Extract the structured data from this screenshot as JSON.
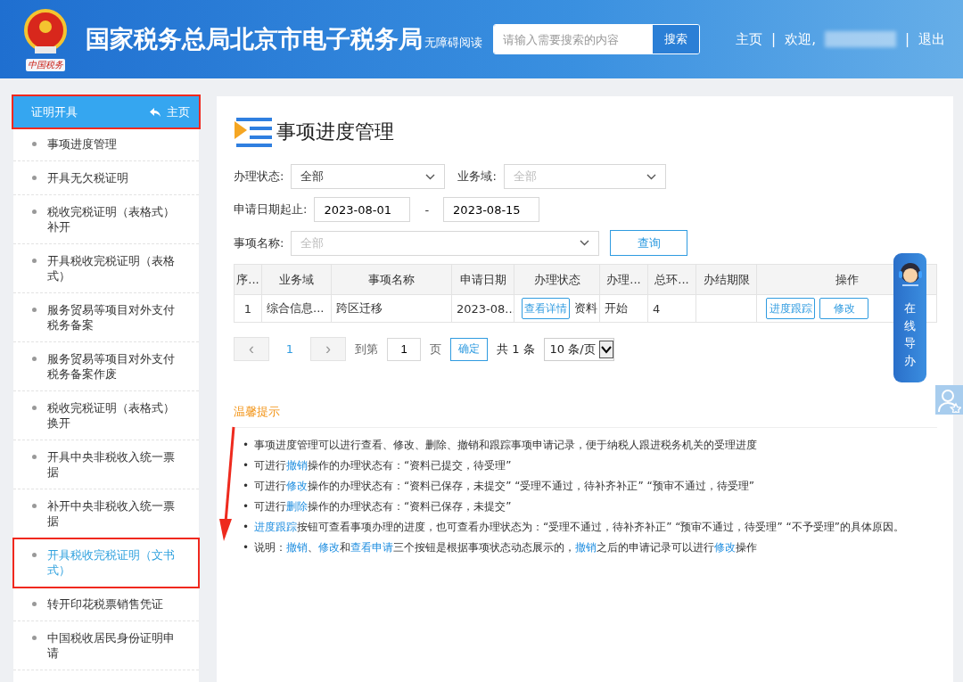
{
  "header": {
    "seal_text": "中国税务",
    "title": "国家税务总局北京市电子税务局",
    "accessibility": "无障碍阅读",
    "search": {
      "placeholder": "请输入需要搜索的内容",
      "button": "搜索"
    },
    "nav": [
      {
        "kind": "link",
        "text": "主页"
      },
      {
        "kind": "sep",
        "text": "|"
      },
      {
        "kind": "text",
        "text": "欢迎,"
      },
      {
        "kind": "sep",
        "text": "|"
      },
      {
        "kind": "link",
        "text": "退出"
      }
    ]
  },
  "sidebar": {
    "title": "证明开具",
    "home": "主页",
    "highlighted": true,
    "items": [
      {
        "label": "事项进度管理",
        "selected": false,
        "highlighted": false
      },
      {
        "label": "开具无欠税证明",
        "selected": false,
        "highlighted": false
      },
      {
        "label": "税收完税证明（表格式）补开",
        "selected": false,
        "highlighted": false
      },
      {
        "label": "开具税收完税证明（表格式）",
        "selected": false,
        "highlighted": false
      },
      {
        "label": "服务贸易等项目对外支付税务备案",
        "selected": false,
        "highlighted": false
      },
      {
        "label": "服务贸易等项目对外支付税务备案作废",
        "selected": false,
        "highlighted": false
      },
      {
        "label": "税收完税证明（表格式）换开",
        "selected": false,
        "highlighted": false
      },
      {
        "label": "开具中央非税收入统一票据",
        "selected": false,
        "highlighted": false
      },
      {
        "label": "补开中央非税收入统一票据",
        "selected": false,
        "highlighted": false
      },
      {
        "label": "开具税收完税证明（文书式）",
        "selected": true,
        "highlighted": true
      },
      {
        "label": "转开印花税票销售凭证",
        "selected": false,
        "highlighted": false
      },
      {
        "label": "中国税收居民身份证明申请",
        "selected": false,
        "highlighted": false
      }
    ]
  },
  "page_title": "事项进度管理",
  "filters": {
    "status": {
      "label": "办理状态:",
      "value": "全部"
    },
    "domain": {
      "label": "业务域:",
      "placeholder": "全部"
    },
    "date": {
      "label": "申请日期起止:",
      "from": "2023-08-01",
      "dash": "-",
      "to": "2023-08-15"
    },
    "name": {
      "label": "事项名称:",
      "placeholder": "全部"
    },
    "query_button": "查询"
  },
  "table": {
    "columns": [
      "序...",
      "业务域",
      "事项名称",
      "申请日期",
      "办理状态",
      "办理...",
      "总环...",
      "办结期限",
      "操作"
    ],
    "rows": [
      {
        "cells": [
          "1",
          "综合信息...",
          "跨区迁移",
          "2023-08...",
          "资料",
          "开始",
          "4",
          ""
        ],
        "detail_button": "查看详情",
        "actions": [
          "进度跟踪",
          "修改"
        ]
      }
    ]
  },
  "pagination": {
    "prev": "‹",
    "pages": [
      {
        "label": "1",
        "selected": true
      }
    ],
    "next": "›",
    "goto": "到第",
    "page_value": "1",
    "page_unit": "页",
    "confirm": "确定",
    "total": "共 1 条",
    "page_size": "10 条/页"
  },
  "tips": {
    "title": "温馨提示",
    "items": [
      {
        "marker": "•",
        "parts": [
          {
            "text": "事项进度管理可以进行查看、修改、删除、撤销和跟踪事项申请记录，便于纳税人跟进税务机关的受理进度",
            "link": false
          }
        ]
      },
      {
        "marker": "•",
        "parts": [
          {
            "text": "可进行",
            "link": false
          },
          {
            "text": "撤销",
            "link": true
          },
          {
            "text": "操作的办理状态有：“资料已提交，待受理”",
            "link": false
          }
        ]
      },
      {
        "marker": "•",
        "parts": [
          {
            "text": "可进行",
            "link": false
          },
          {
            "text": "修改",
            "link": true
          },
          {
            "text": "操作的办理状态有：“资料已保存，未提交”  “受理不通过，待补齐补正”  “预审不通过，待受理”",
            "link": false
          }
        ]
      },
      {
        "marker": "•",
        "parts": [
          {
            "text": "可进行",
            "link": false
          },
          {
            "text": "删除",
            "link": true
          },
          {
            "text": "操作的办理状态有：“资料已保存，未提交”",
            "link": false
          }
        ]
      },
      {
        "marker": "•",
        "parts": [
          {
            "text": "进度跟踪",
            "link": true
          },
          {
            "text": "按钮可查看事项办理的进度，也可查看办理状态为：“受理不通过，待补齐补正”  “预审不通过，待受理”  “不予受理”的具体原因。",
            "link": false
          }
        ]
      },
      {
        "marker": "•",
        "parts": [
          {
            "text": "说明：",
            "link": false
          },
          {
            "text": "撤销",
            "link": true
          },
          {
            "text": "、",
            "link": false
          },
          {
            "text": "修改",
            "link": true
          },
          {
            "text": "和",
            "link": false
          },
          {
            "text": "查看申请",
            "link": true
          },
          {
            "text": "三个按钮是根据事项状态动态展示的，",
            "link": false
          },
          {
            "text": "撤销",
            "link": true
          },
          {
            "text": "之后的申请记录可以进行",
            "link": false
          },
          {
            "text": "修改",
            "link": true
          },
          {
            "text": "操作",
            "link": false
          }
        ]
      }
    ]
  },
  "assistant": {
    "label": "在线导办"
  },
  "annotation_arrow": true
}
